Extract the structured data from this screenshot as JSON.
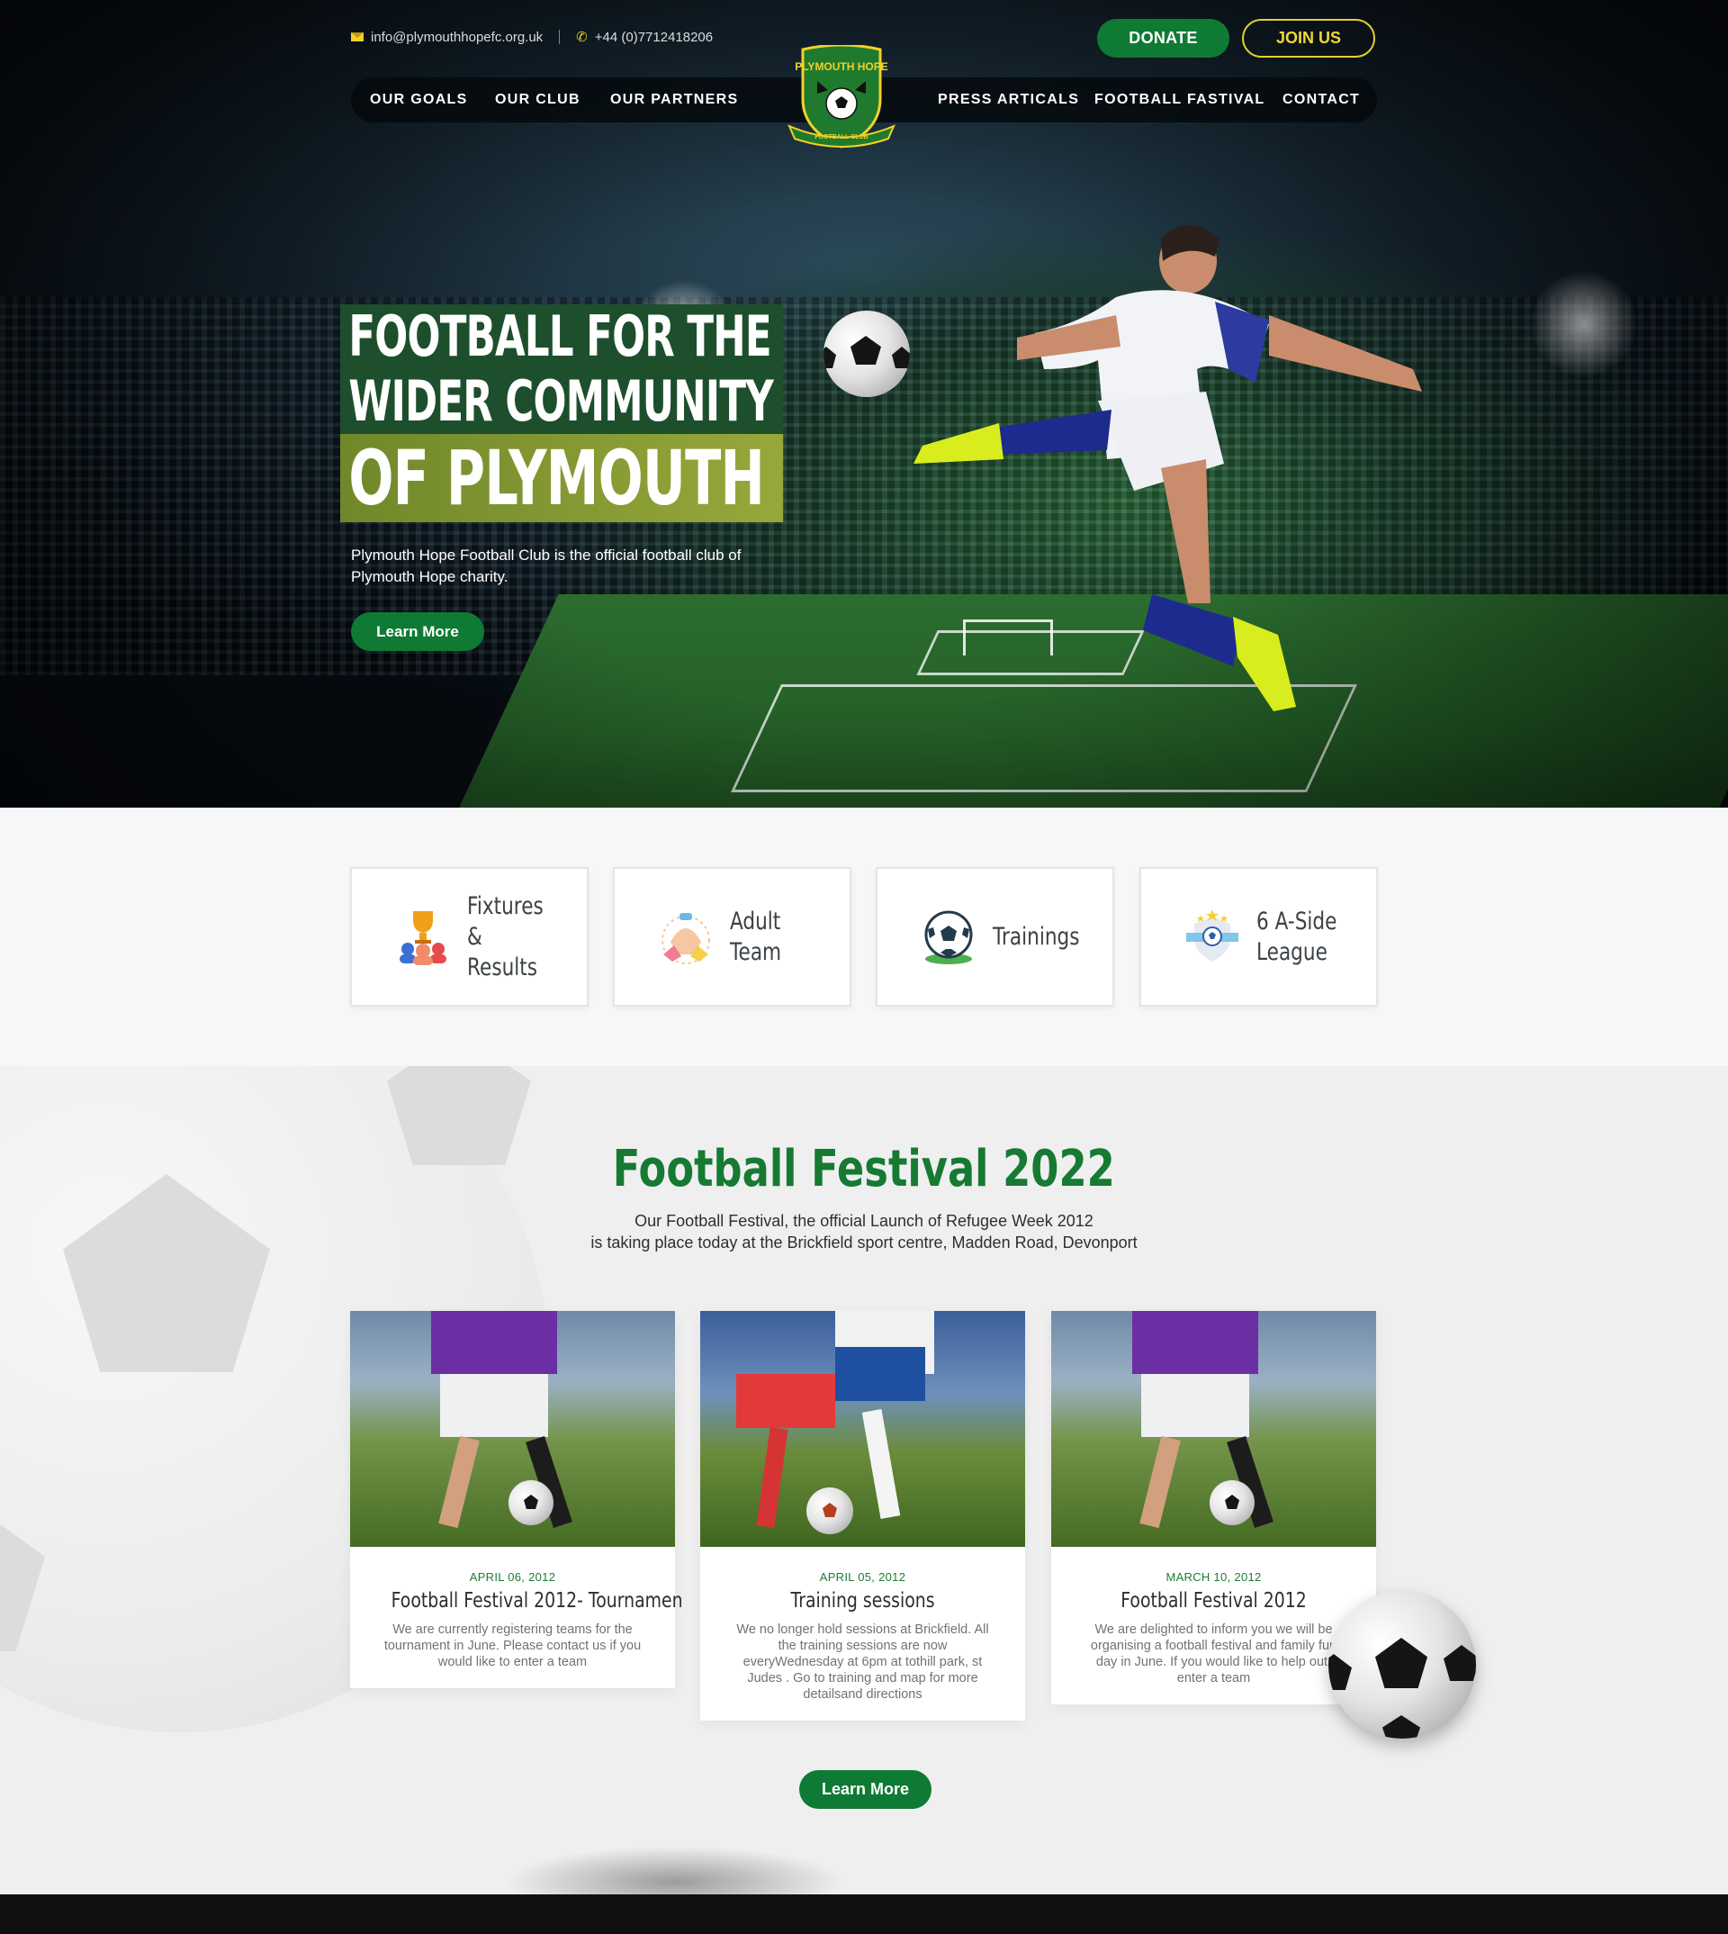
{
  "topbar": {
    "email": "info@plymouthhopefc.org.uk",
    "phone": "+44 (0)7712418206",
    "donate_label": "DONATE",
    "join_label": "JOIN US"
  },
  "nav": {
    "items": [
      "OUR GOALS",
      "OUR CLUB",
      "OUR PARTNERS",
      "PRESS ARTICALS",
      "FOOTBALL FASTIVAL",
      "CONTACT"
    ]
  },
  "crest": {
    "top_text": "PLYMOUTH HOPE",
    "bottom_text": "FOOTBALL CLUB"
  },
  "hero": {
    "line1": "FOOTBALL FOR THE",
    "line2": "WIDER COMMUNITY",
    "line3": "OF PLYMOUTH",
    "description": "Plymouth Hope Football Club is the official football club of Plymouth Hope charity.",
    "cta": "Learn More"
  },
  "features": [
    {
      "label": "Fixtures &\nResults",
      "icon": "trophy-team-icon"
    },
    {
      "label": "Adult\nTeam",
      "icon": "hands-together-icon"
    },
    {
      "label": "Trainings",
      "icon": "soccer-ball-icon"
    },
    {
      "label": "6 A-Side\nLeague",
      "icon": "league-badge-icon"
    }
  ],
  "festival": {
    "title": "Football Festival 2022",
    "subtitle_line1": "Our Football Festival, the official Launch of Refugee Week 2012",
    "subtitle_line2": "is taking place today at the Brickfield sport centre, Madden Road, Devonport",
    "posts": [
      {
        "date": "APRIL 06, 2012",
        "title": "Football Festival 2012- Tournamen",
        "text": "We are currently registering teams for the tournament in June. Please contact us if you would like to enter a team"
      },
      {
        "date": "APRIL 05, 2012",
        "title": "Training sessions",
        "text": "We no longer hold sessions at Brickfield. All the training sessions are now everyWednesday at 6pm at tothill park, st Judes . Go to training and map for more detailsand directions"
      },
      {
        "date": "MARCH 10, 2012",
        "title": "Football Festival 2012",
        "text": "We are delighted to inform you we will be organising a football festival and family fun day in June. If you would like to help out, enter a team"
      }
    ],
    "cta": "Learn More"
  },
  "colors": {
    "brand_green": "#0f7a33",
    "accent_yellow": "#efd83a",
    "title_green": "#167a33"
  }
}
